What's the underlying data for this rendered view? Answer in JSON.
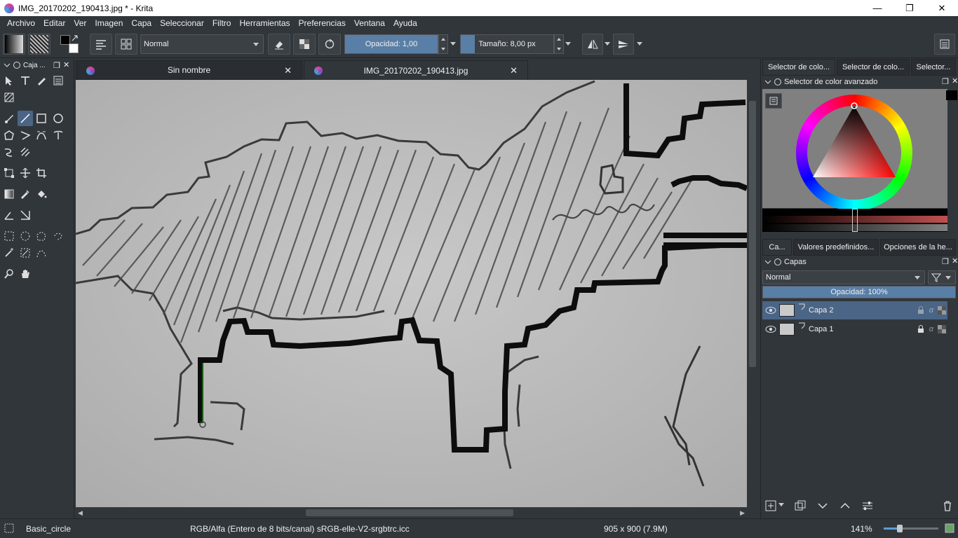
{
  "window": {
    "title": "IMG_20170202_190413.jpg * - Krita",
    "minimize": "—",
    "maximize": "❐",
    "close": "✕"
  },
  "menu": [
    "Archivo",
    "Editar",
    "Ver",
    "Imagen",
    "Capa",
    "Seleccionar",
    "Filtro",
    "Herramientas",
    "Preferencias",
    "Ventana",
    "Ayuda"
  ],
  "tool_options": {
    "blend_mode": "Normal",
    "opacity_label": "Opacidad:  1,00",
    "opacity": 1.0,
    "size_label": "Tamaño:  8,00 px",
    "size_fraction": 0.15
  },
  "toolbox": {
    "title": "Caja ..."
  },
  "document_tabs": [
    {
      "label": "Sin nombre",
      "active": false
    },
    {
      "label": "IMG_20170202_190413.jpg",
      "active": true
    }
  ],
  "dock": {
    "color_tabs": [
      "Selector de colo...",
      "Selector de colo...",
      "Selector..."
    ],
    "color_panel_title": "Selector de color avanzado",
    "bottom_tabs": [
      "Ca...",
      "Valores predefinidos...",
      "Opciones de la he..."
    ],
    "layers_title": "Capas",
    "layers_blend": "Normal",
    "layers_opacity_label": "Opacidad:  100%",
    "layers_opacity": 1.0,
    "layers": [
      {
        "name": "Capa 2",
        "selected": true
      },
      {
        "name": "Capa 1",
        "selected": false
      }
    ]
  },
  "status": {
    "brush": "Basic_circle",
    "color_profile": "RGB/Alfa (Entero de 8 bits/canal)  sRGB-elle-V2-srgbtrc.icc",
    "dimensions": "905 x 900 (7.9M)",
    "zoom": "141%",
    "zoom_fraction": 0.3
  }
}
